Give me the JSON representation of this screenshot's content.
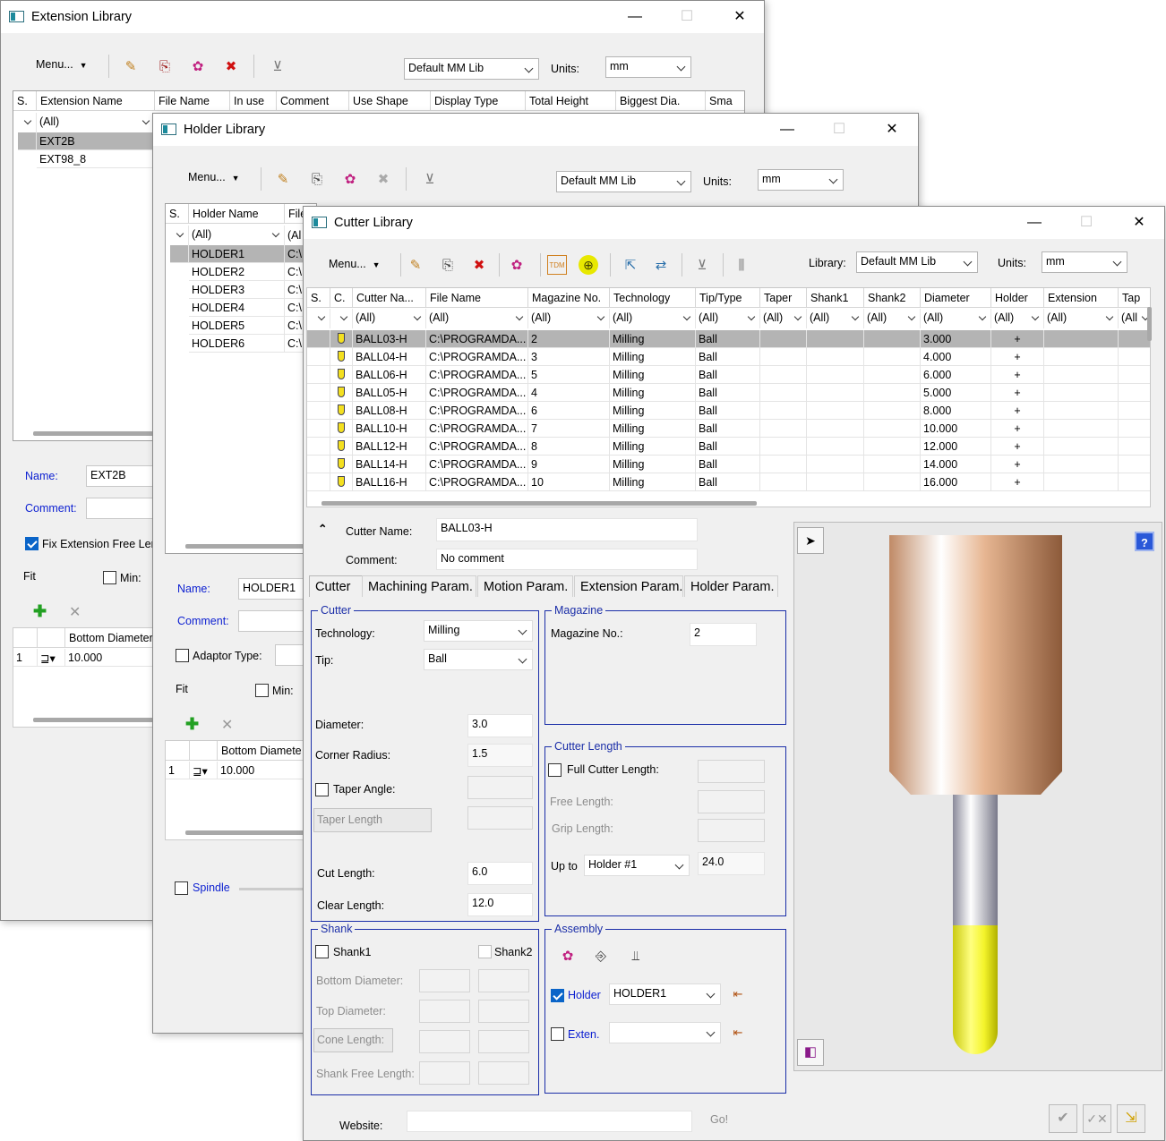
{
  "extension_window": {
    "title": "Extension Library",
    "menu": "Menu...",
    "library_combo": "Default MM Lib",
    "units_label": "Units:",
    "units_value": "mm",
    "columns": [
      "S.",
      "Extension Name",
      "File Name",
      "In use",
      "Comment",
      "Use Shape",
      "Display Type",
      "Total Height",
      "Biggest Dia.",
      "Sma"
    ],
    "filter": "(All)",
    "rows": [
      "EXT2B",
      "EXT98_8"
    ],
    "name_label": "Name:",
    "name_value": "EXT2B",
    "comment_label": "Comment:",
    "fix_label": "Fix Extension Free Ler",
    "fit_label": "Fit",
    "min_label": "Min:",
    "grid_header": "Bottom Diameter",
    "grid_row_num": "1",
    "grid_row_value": "10.000"
  },
  "holder_window": {
    "title": "Holder Library",
    "menu": "Menu...",
    "library_combo": "Default MM Lib",
    "units_label": "Units:",
    "units_value": "mm",
    "columns": [
      "S.",
      "Holder Name",
      "File"
    ],
    "filter": "(All)",
    "filter_file": "(Al",
    "rows": [
      "HOLDER1",
      "HOLDER2",
      "HOLDER3",
      "HOLDER4",
      "HOLDER5",
      "HOLDER6"
    ],
    "file_prefix": "C:\\",
    "name_label": "Name:",
    "name_value": "HOLDER1",
    "comment_label": "Comment:",
    "adaptor_label": "Adaptor Type:",
    "fit_label": "Fit",
    "min_label": "Min:",
    "grid_header": "Bottom Diamete",
    "grid_row_num": "1",
    "grid_row_value": "10.000",
    "spindle_label": "Spindle"
  },
  "cutter_window": {
    "title": "Cutter Library",
    "menu": "Menu...",
    "library_label": "Library:",
    "library_combo": "Default MM Lib",
    "units_label": "Units:",
    "units_value": "mm",
    "columns": [
      "S.",
      "C.",
      "Cutter Na...",
      "File Name",
      "Magazine No.",
      "Technology",
      "Tip/Type",
      "Taper",
      "Shank1",
      "Shank2",
      "Diameter",
      "Holder",
      "Extension",
      "Tap"
    ],
    "filters": [
      "",
      "",
      "(All)",
      "(All)",
      "(All)",
      "(All)",
      "(All)",
      "(All)",
      "(All)",
      "(All)",
      "(All)",
      "(All)",
      "(All)",
      "(All"
    ],
    "rows": [
      {
        "name": "BALL03-H",
        "file": "C:\\PROGRAMDA...",
        "mag": "2",
        "tech": "Milling",
        "tip": "Ball",
        "dia": "3.000",
        "holder": "+"
      },
      {
        "name": "BALL04-H",
        "file": "C:\\PROGRAMDA...",
        "mag": "3",
        "tech": "Milling",
        "tip": "Ball",
        "dia": "4.000",
        "holder": "+"
      },
      {
        "name": "BALL06-H",
        "file": "C:\\PROGRAMDA...",
        "mag": "5",
        "tech": "Milling",
        "tip": "Ball",
        "dia": "6.000",
        "holder": "+"
      },
      {
        "name": "BALL05-H",
        "file": "C:\\PROGRAMDA...",
        "mag": "4",
        "tech": "Milling",
        "tip": "Ball",
        "dia": "5.000",
        "holder": "+"
      },
      {
        "name": "BALL08-H",
        "file": "C:\\PROGRAMDA...",
        "mag": "6",
        "tech": "Milling",
        "tip": "Ball",
        "dia": "8.000",
        "holder": "+"
      },
      {
        "name": "BALL10-H",
        "file": "C:\\PROGRAMDA...",
        "mag": "7",
        "tech": "Milling",
        "tip": "Ball",
        "dia": "10.000",
        "holder": "+"
      },
      {
        "name": "BALL12-H",
        "file": "C:\\PROGRAMDA...",
        "mag": "8",
        "tech": "Milling",
        "tip": "Ball",
        "dia": "12.000",
        "holder": "+"
      },
      {
        "name": "BALL14-H",
        "file": "C:\\PROGRAMDA...",
        "mag": "9",
        "tech": "Milling",
        "tip": "Ball",
        "dia": "14.000",
        "holder": "+"
      },
      {
        "name": "BALL16-H",
        "file": "C:\\PROGRAMDA...",
        "mag": "10",
        "tech": "Milling",
        "tip": "Ball",
        "dia": "16.000",
        "holder": "+"
      }
    ],
    "cutter_name_label": "Cutter Name:",
    "cutter_name_value": "BALL03-H",
    "comment_label": "Comment:",
    "comment_value": "No comment",
    "tabs": [
      "Cutter",
      "Machining Param.",
      "Motion Param.",
      "Extension Param.",
      "Holder Param."
    ],
    "cutter_group": {
      "title": "Cutter",
      "technology_label": "Technology:",
      "technology_value": "Milling",
      "tip_label": "Tip:",
      "tip_value": "Ball",
      "diameter_label": "Diameter:",
      "diameter_value": "3.0",
      "corner_label": "Corner Radius:",
      "corner_value": "1.5",
      "taper_angle_label": "Taper Angle:",
      "taper_length_label": "Taper Length",
      "cut_length_label": "Cut Length:",
      "cut_length_value": "6.0",
      "clear_length_label": "Clear Length:",
      "clear_length_value": "12.0"
    },
    "magazine_group": {
      "title": "Magazine",
      "label": "Magazine No.:",
      "value": "2"
    },
    "length_group": {
      "title": "Cutter Length",
      "full_label": "Full Cutter Length:",
      "free_label": "Free Length:",
      "grip_label": "Grip Length:",
      "upto_label": "Up to",
      "upto_value": "Holder #1",
      "upto_length": "24.0"
    },
    "shank_group": {
      "title": "Shank",
      "shank1": "Shank1",
      "shank2": "Shank2",
      "bottom": "Bottom Diameter:",
      "top": "Top Diameter:",
      "cone": "Cone Length:",
      "free": "Shank Free Length:"
    },
    "assembly_group": {
      "title": "Assembly",
      "holder_label": "Holder",
      "holder_value": "HOLDER1",
      "exten_label": "Exten."
    },
    "website_label": "Website:",
    "go_label": "Go!",
    "colors": {
      "selected_row": "#b4b4b4",
      "group_border": "#1b2ea8",
      "holder_copper": "#d9a27f",
      "shank_gray": "#c2c2cc",
      "flute_yellow": "#f4f42a"
    }
  }
}
